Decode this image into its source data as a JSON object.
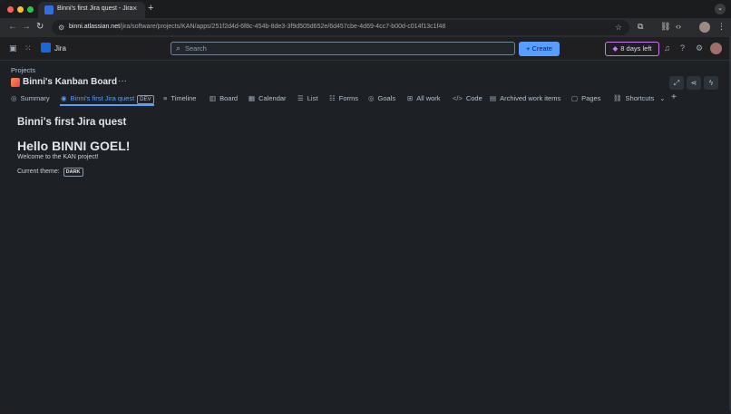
{
  "browser": {
    "tab_title": "Binni's first Jira quest - Jira",
    "tab_close": "×",
    "new_tab": "+",
    "tab_menu": "⌄",
    "url_host": "binni.atlassian.net",
    "url_path": "/jira/software/projects/KAN/apps/251f2d4d-6f8c-454b-8de3-3f9d505d652e/6d457cbe-4d69-4cc7-b00d-c014f13c1f48",
    "back_icon": "←",
    "forward_icon": "→",
    "reload_icon": "↻",
    "site_info_icon": "⚙",
    "star_icon": "☆"
  },
  "jira_nav": {
    "app_name": "Jira",
    "search_placeholder": "Search",
    "create_label": "+ Create",
    "trial_label": "8 days left",
    "trial_icon": "◆",
    "colors": {
      "create_bg": "#579dff",
      "trial_border": "#c97cf4"
    }
  },
  "project": {
    "breadcrumb": "Projects",
    "title": "Binni's Kanban Board",
    "more": "···"
  },
  "tabs": [
    {
      "icon": "◎",
      "label": "Summary"
    },
    {
      "icon": "◉",
      "label": "Binni's first Jira quest",
      "badge": "DEV",
      "active": true
    },
    {
      "icon": "≡",
      "label": "Timeline"
    },
    {
      "icon": "▥",
      "label": "Board"
    },
    {
      "icon": "▦",
      "label": "Calendar"
    },
    {
      "icon": "☰",
      "label": "List"
    },
    {
      "icon": "☷",
      "label": "Forms"
    },
    {
      "icon": "◎",
      "label": "Goals"
    },
    {
      "icon": "⊞",
      "label": "All work"
    },
    {
      "icon": "</>",
      "label": "Code"
    },
    {
      "icon": "▤",
      "label": "Archived work items"
    },
    {
      "icon": "▢",
      "label": "Pages"
    },
    {
      "icon": "⛓",
      "label": "Shortcuts"
    }
  ],
  "content": {
    "title": "Binni's first Jira quest",
    "greeting": "Hello BINNI GOEL!",
    "welcome": "Welcome to the KAN project!",
    "theme_label": "Current theme:",
    "theme_value": "DARK"
  }
}
